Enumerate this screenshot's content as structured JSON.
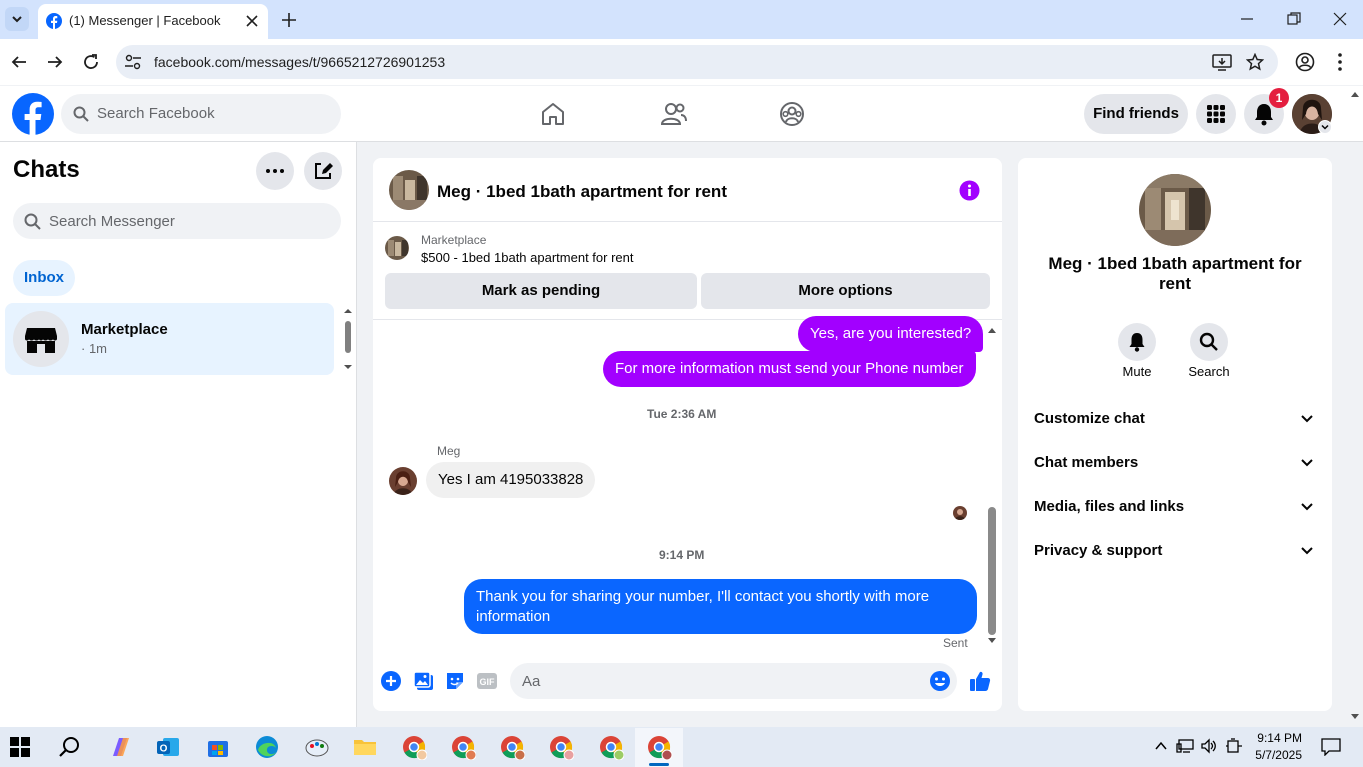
{
  "browser": {
    "tab_title": "(1) Messenger | Facebook",
    "url": "facebook.com/messages/t/9665212726901253"
  },
  "fb_header": {
    "search_placeholder": "Search Facebook",
    "find_friends": "Find friends",
    "notification_count": "1"
  },
  "sidebar": {
    "title": "Chats",
    "search_placeholder": "Search Messenger",
    "filter": "Inbox",
    "chats": [
      {
        "name": "Marketplace",
        "time": "· 1m"
      }
    ]
  },
  "conversation": {
    "title": "Meg · 1bed 1bath apartment for rent",
    "listing_label": "Marketplace",
    "listing_text": "$500 - 1bed 1bath apartment for rent",
    "mark_pending": "Mark as pending",
    "more_options": "More options",
    "messages": [
      {
        "text": "Yes, are you interested?",
        "from": "me"
      },
      {
        "text": "For more information must send your Phone number",
        "from": "me"
      },
      {
        "timestamp": "Tue 2:36 AM"
      },
      {
        "sender": "Meg",
        "text": "Yes I am 4195033828",
        "from": "them"
      },
      {
        "timestamp": "9:14 PM"
      },
      {
        "text_line1": "Thank you for sharing your number, I'll contact you shortly with more",
        "text_line2": "information",
        "from": "me"
      }
    ],
    "status": "Sent",
    "composer_placeholder": "Aa"
  },
  "info_panel": {
    "name": "Meg · 1bed 1bath apartment for rent",
    "actions": [
      "Mute",
      "Search"
    ],
    "sections": [
      "Customize chat",
      "Chat members",
      "Media, files and links",
      "Privacy & support"
    ]
  },
  "taskbar": {
    "time": "9:14 PM",
    "date": "5/7/2025"
  },
  "colors": {
    "accent_purple": "#a200ff",
    "messenger_blue": "#0a66ff",
    "fb_blue": "#0866ff"
  }
}
